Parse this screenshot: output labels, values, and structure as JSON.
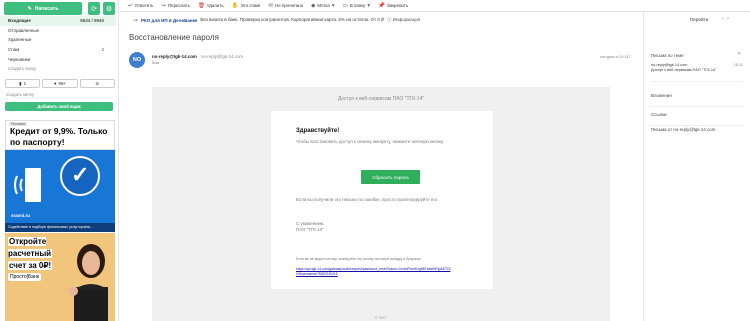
{
  "sidebar": {
    "compose_label": "Написать",
    "folders": [
      {
        "name": "Входящие",
        "count": "8634 / 9940",
        "active": true
      },
      {
        "name": "Отправленные",
        "count": ""
      },
      {
        "name": "Удаленные",
        "count": ""
      },
      {
        "name": "Спам",
        "count": "2"
      },
      {
        "name": "Черновики",
        "count": ""
      }
    ],
    "create_folder": "Создать папку",
    "chip_flag": "1",
    "chip_attach": "99+",
    "create_tag": "Создать метку",
    "add_mailbox": "Добавить свой ящик"
  },
  "ads": {
    "ad1_badge": "Реклама",
    "ad1_title": "Кредит от 9,9%. Только по паспорту!",
    "ad1_brand": "sravni.ru",
    "ad1_caption": "Содействие в подборе финансовых услуг/органи...",
    "ad2_title_1": "Откройте расчетный",
    "ad2_title_2": "счет за 0₽!",
    "ad2_logo": "Просто|Банк"
  },
  "toolbar": {
    "items": [
      "Ответить",
      "Переслать",
      "Удалить",
      "Это спам!",
      "Не прочитано",
      "Метка",
      "В папку",
      "Закрепить"
    ]
  },
  "adbar": {
    "bold": "РКО для ИП в ДелоБанке",
    "text": "Без визита в банк. Проверка контрагентов. Корпоративная карта. 5% на остаток. От 0 ₽",
    "link": "Информация",
    "goto": "Перейти"
  },
  "email": {
    "subject": "Восстановление пароля",
    "avatar": "NO",
    "from_name": "no-reply@tgk-14.com",
    "from_addr": "no-reply@tgk-14.com",
    "to": "Вам",
    "date": "сегодня в 15:11",
    "header": "Доступ к веб-сервисам ПАО \"ТГК-14\"",
    "greeting": "Здравствуйте!",
    "p1": "Чтобы восстановить доступ к своему аккаунту, нажмите зеленую кнопку.",
    "button": "Сбросить пароль",
    "p2": "Если вы получили это письмо по ошибке, просто проигнорируйте его",
    "sign_1": "С уважением,",
    "sign_2": "ПАО \"ТГК-14\"",
    "note": "Если вы не видите кнопку, скопируйте эту ссылку на новую вкладку в браузере.",
    "url": "https://api.tgk-14.com/gateway/auth/request/password_reset?token=XcmhPvcnEzg68TbaWhPjpAETOlHJbaemamse78620240415",
    "copyright": "© 2017"
  },
  "right": {
    "thread_title": "Письма по теме",
    "thread_from": "no-reply@tgk-14.com",
    "thread_date": "15:11",
    "thread_subject": "Доступ к веб-сервисам ПАО \"ТГК-14\"",
    "attachments": "Вложения",
    "links": "Ссылки",
    "from_sender": "Письма от no-reply@tgk-14.com"
  },
  "colors": {
    "accent": "#3fbf7f",
    "button": "#2fae5c",
    "avatar": "#3c7fd3"
  }
}
